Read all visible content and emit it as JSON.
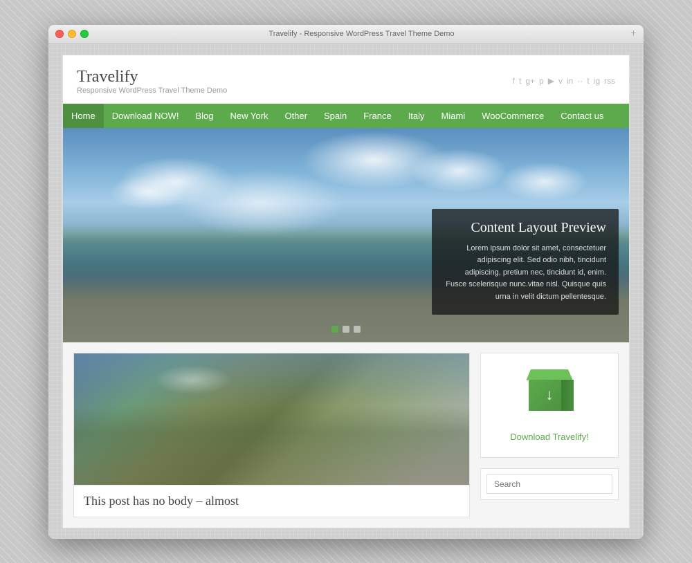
{
  "window": {
    "title": "Travelify - Responsive WordPress Travel Theme Demo"
  },
  "header": {
    "logo": "Travelify",
    "tagline": "Responsive WordPress Travel Theme Demo"
  },
  "nav": {
    "items": [
      {
        "label": "Home",
        "active": true
      },
      {
        "label": "Download NOW!"
      },
      {
        "label": "Blog"
      },
      {
        "label": "New York"
      },
      {
        "label": "Other"
      },
      {
        "label": "Spain"
      },
      {
        "label": "France"
      },
      {
        "label": "Italy"
      },
      {
        "label": "Miami"
      },
      {
        "label": "WooCommerce"
      },
      {
        "label": "Contact us"
      }
    ]
  },
  "hero": {
    "title": "Content Layout Preview",
    "body": "Lorem ipsum dolor sit amet, consectetuer adipiscing elit. Sed odio nibh, tincidunt adipiscing, pretium nec, tincidunt id, enim. Fusce scelerisque nunc.vitae nisl. Quisque quis urna in velit dictum pellentesque.",
    "dots": [
      {
        "active": true
      },
      {
        "active": false
      },
      {
        "active": false
      }
    ]
  },
  "post": {
    "title": "This post has no body – almost"
  },
  "sidebar": {
    "download_label": "Download Travelify!",
    "search_placeholder": "Search"
  },
  "social": {
    "icons": [
      "f",
      "t",
      "g+",
      "p",
      "yt",
      "v",
      "in",
      "··",
      "t",
      "ig",
      "rss"
    ]
  }
}
